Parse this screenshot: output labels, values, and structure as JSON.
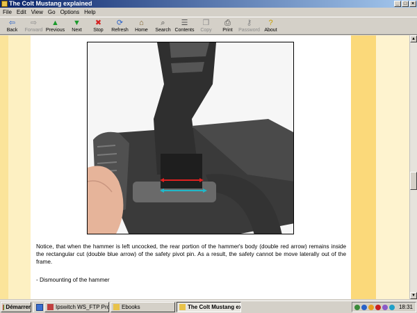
{
  "window": {
    "title": "The Colt Mustang explained"
  },
  "menu": [
    "File",
    "Edit",
    "View",
    "Go",
    "Options",
    "Help"
  ],
  "toolbar": [
    {
      "label": "Back",
      "icon": "back-arrow-icon",
      "glyph": "⇦",
      "color": "#2a62c8",
      "enabled": true
    },
    {
      "label": "Forward",
      "icon": "forward-arrow-icon",
      "glyph": "⇨",
      "color": "#8a8a8a",
      "enabled": false
    },
    {
      "label": "Previous",
      "icon": "up-arrow-icon",
      "glyph": "▲",
      "color": "#1a9a2a",
      "enabled": true
    },
    {
      "label": "Next",
      "icon": "down-arrow-icon",
      "glyph": "▼",
      "color": "#1a9a2a",
      "enabled": true
    },
    {
      "label": "Stop",
      "icon": "stop-icon",
      "glyph": "✖",
      "color": "#d42020",
      "enabled": true
    },
    {
      "label": "Refresh",
      "icon": "refresh-icon",
      "glyph": "⟳",
      "color": "#2a62c8",
      "enabled": true
    },
    {
      "label": "Home",
      "icon": "home-icon",
      "glyph": "⌂",
      "color": "#7a5a20",
      "enabled": true
    },
    {
      "label": "Search",
      "icon": "search-icon",
      "glyph": "⌕",
      "color": "#404040",
      "enabled": true
    },
    {
      "label": "Contents",
      "icon": "contents-icon",
      "glyph": "☰",
      "color": "#505050",
      "enabled": true
    },
    {
      "label": "Copy",
      "icon": "copy-icon",
      "glyph": "❐",
      "color": "#8a8a8a",
      "enabled": false
    },
    {
      "label": "Print",
      "icon": "print-icon",
      "glyph": "⎙",
      "color": "#404040",
      "enabled": true
    },
    {
      "label": "Password",
      "icon": "key-icon",
      "glyph": "⚷",
      "color": "#8a8a8a",
      "enabled": false
    },
    {
      "label": "About",
      "icon": "help-icon",
      "glyph": "?",
      "color": "#c8a000",
      "enabled": true
    }
  ],
  "content": {
    "caption": "Notice, that when the hammer is left uncocked, the rear portion of the hammer's body (double red arrow) remains inside the rectangular cut (double blue arrow) of the safety pivot pin. As a result, the safety cannot be move laterally out of the frame.",
    "subheading": "- Dismounting of the hammer"
  },
  "taskbar": {
    "start_label": "Démarrer",
    "tasks": [
      {
        "label": "Ipswitch WS_FTP Profes...",
        "active": false,
        "icon_color": "#c04040"
      },
      {
        "label": "Ebooks",
        "active": false,
        "icon_color": "#e8c24a"
      },
      {
        "label": "The Colt Mustang expl...",
        "active": true,
        "icon_color": "#e8c24a"
      }
    ],
    "clock": "18:31"
  },
  "colors": {
    "titlebar_start": "#0a246a",
    "band_left": "#fbe49a",
    "band_right": "#fbd97a",
    "red_arrow": "#e02020",
    "blue_arrow": "#20b8c8"
  }
}
